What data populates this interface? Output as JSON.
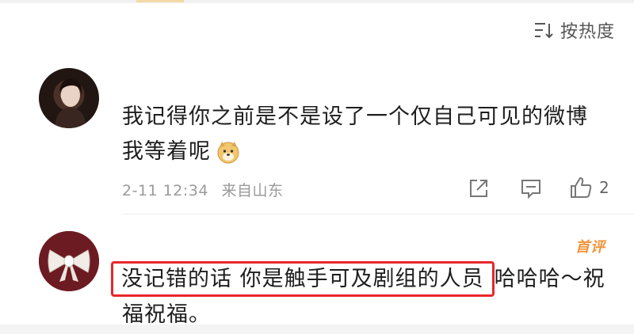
{
  "sort": {
    "label": "按热度",
    "icon": "sort-icon"
  },
  "comments": [
    {
      "avatar": "avatar-photo-woman",
      "lines": [
        "我记得你之前是不是设了一个仅自己可见的微博",
        "我等着呢"
      ],
      "emoji": "doge-emoji",
      "time": "2-11 12:34",
      "source": "来自山东",
      "actions": {
        "share_icon": "share-icon",
        "comment_icon": "comment-icon",
        "like_icon": "like-icon",
        "like_count": "2"
      }
    },
    {
      "avatar": "avatar-bow",
      "badge": "首评",
      "highlighted": "没记错的话 你是触手可及剧组的人员",
      "rest": "哈哈哈～祝",
      "line2": "福祝福。"
    }
  ]
}
